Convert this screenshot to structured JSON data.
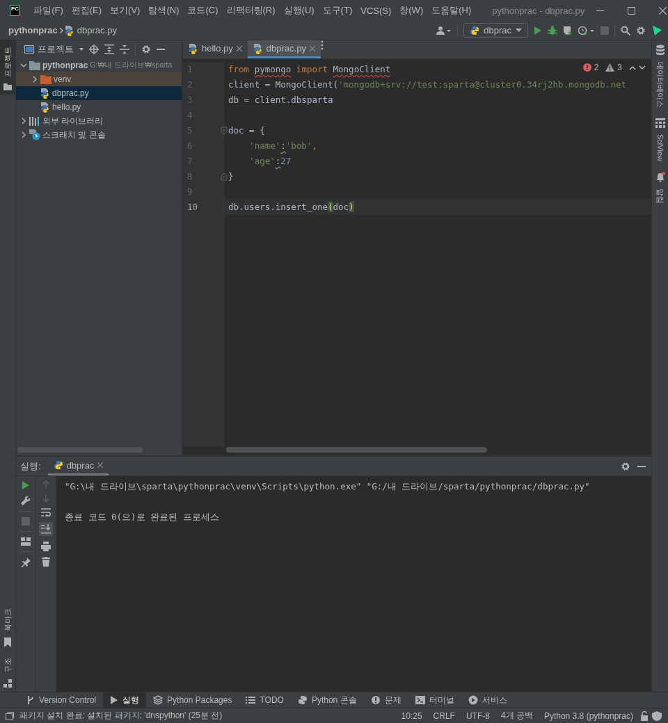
{
  "window": {
    "app_icon": "PC",
    "menu": [
      "파일(F)",
      "편집(E)",
      "보기(V)",
      "탐색(N)",
      "코드(C)",
      "리팩터링(R)",
      "실행(U)",
      "도구(T)",
      "VCS(S)",
      "창(W)",
      "도움말(H)"
    ],
    "title": "pythonprac - dbprac.py"
  },
  "navbar": {
    "breadcrumb": [
      "pythonprac",
      "dbprac.py"
    ],
    "run_config": "dbprac"
  },
  "left_stripe": {
    "top": [
      {
        "label": "프로젝트",
        "selected": true
      }
    ],
    "bottom": [
      {
        "label": "북마크",
        "kind": "bookmarks",
        "selected": false
      },
      {
        "label": "구조",
        "kind": "structure",
        "selected": false
      }
    ]
  },
  "right_stripe": [
    {
      "label": "데이터베이스",
      "kind": "database"
    },
    {
      "label": "SciView",
      "kind": "sciview"
    },
    {
      "label": "알림",
      "kind": "notifications"
    }
  ],
  "project": {
    "title": "프로젝트",
    "tree": [
      {
        "label": "pythonprac",
        "hint": "G:₩내 드라이브₩sparta",
        "kind": "project",
        "expanded": true,
        "selected": false,
        "children": [
          {
            "label": "venv",
            "kind": "excluded-folder",
            "expanded": false,
            "selected": false
          },
          {
            "label": "dbprac.py",
            "kind": "python-file",
            "selected": true
          },
          {
            "label": "hello.py",
            "kind": "python-file",
            "selected": false
          }
        ]
      },
      {
        "label": "외부 라이브러리",
        "kind": "libraries",
        "expanded": false,
        "selected": false
      },
      {
        "label": "스크래치 및 콘솔",
        "kind": "scratches",
        "expanded": false,
        "selected": false
      }
    ]
  },
  "editor": {
    "tabs": [
      {
        "label": "hello.py",
        "selected": false
      },
      {
        "label": "dbprac.py",
        "selected": true
      }
    ],
    "errors": "2",
    "warnings": "3",
    "lines": [
      {
        "number": "1",
        "current": false,
        "tokens": [
          {
            "kind": "kw",
            "text": "from "
          },
          {
            "kind": "err",
            "text": "pymongo"
          },
          {
            "kind": "kw",
            "text": " import "
          },
          {
            "kind": "err",
            "text": "MongoClient"
          }
        ]
      },
      {
        "number": "2",
        "current": false,
        "tokens": [
          {
            "kind": "plain",
            "text": "client = MongoClient("
          },
          {
            "kind": "str",
            "text": "'mongodb+srv://test:sparta@cluster0.34rj2hb.mongodb.net"
          }
        ]
      },
      {
        "number": "3",
        "current": false,
        "tokens": [
          {
            "kind": "plain",
            "text": "db = client.dbsparta"
          }
        ]
      },
      {
        "number": "4",
        "current": false
      },
      {
        "number": "5",
        "current": false,
        "fold_open": true,
        "tokens": [
          {
            "kind": "plain",
            "text": "doc = {"
          }
        ]
      },
      {
        "number": "6",
        "current": false,
        "tokens": [
          {
            "kind": "str",
            "text": "    'name'"
          },
          {
            "kind": "warn",
            "text": ":"
          },
          {
            "kind": "str",
            "text": "'bob'"
          },
          {
            "kind": "kw",
            "text": ","
          }
        ]
      },
      {
        "number": "7",
        "current": false,
        "tokens": [
          {
            "kind": "str",
            "text": "    'age'"
          },
          {
            "kind": "warn",
            "text": ":"
          },
          {
            "kind": "num",
            "text": "27"
          }
        ]
      },
      {
        "number": "8",
        "current": false,
        "fold_close": true,
        "tokens": [
          {
            "kind": "plain",
            "text": "}"
          }
        ]
      },
      {
        "number": "9",
        "current": false
      },
      {
        "number": "10",
        "current": true,
        "tokens": [
          {
            "kind": "plain",
            "text": "db.users.insert_one"
          },
          {
            "kind": "match",
            "text": "("
          },
          {
            "kind": "plain",
            "text": "doc"
          },
          {
            "kind": "match",
            "text": ")"
          }
        ]
      }
    ]
  },
  "run": {
    "title": "실행:",
    "tab": "dbprac",
    "output": [
      "\"G:\\내 드라이브\\sparta\\pythonprac\\venv\\Scripts\\python.exe\" \"G:/내 드라이브/sparta/pythonprac/dbprac.py\"",
      "종료 코드 0(으)로 완료된 프로세스"
    ]
  },
  "tool_windows": [
    {
      "label": "Version Control",
      "kind": "vcs",
      "selected": false
    },
    {
      "label": "실행",
      "kind": "run",
      "selected": true
    },
    {
      "label": "Python Packages",
      "kind": "packages",
      "selected": false
    },
    {
      "label": "TODO",
      "kind": "todo",
      "selected": false
    },
    {
      "label": "Python 콘솔",
      "kind": "console",
      "selected": false
    },
    {
      "label": "문제",
      "kind": "problems",
      "selected": false
    },
    {
      "label": "터미널",
      "kind": "terminal",
      "selected": false
    },
    {
      "label": "서비스",
      "kind": "services",
      "selected": false
    }
  ],
  "status_bar": {
    "message": "패키지 설치 완료: 설치된 패키지: 'dnspython' (25분 전)",
    "items": [
      "10:25",
      "CRLF",
      "UTF-8",
      "4개 공백",
      "Python 3.8 (pythonprac)"
    ]
  }
}
